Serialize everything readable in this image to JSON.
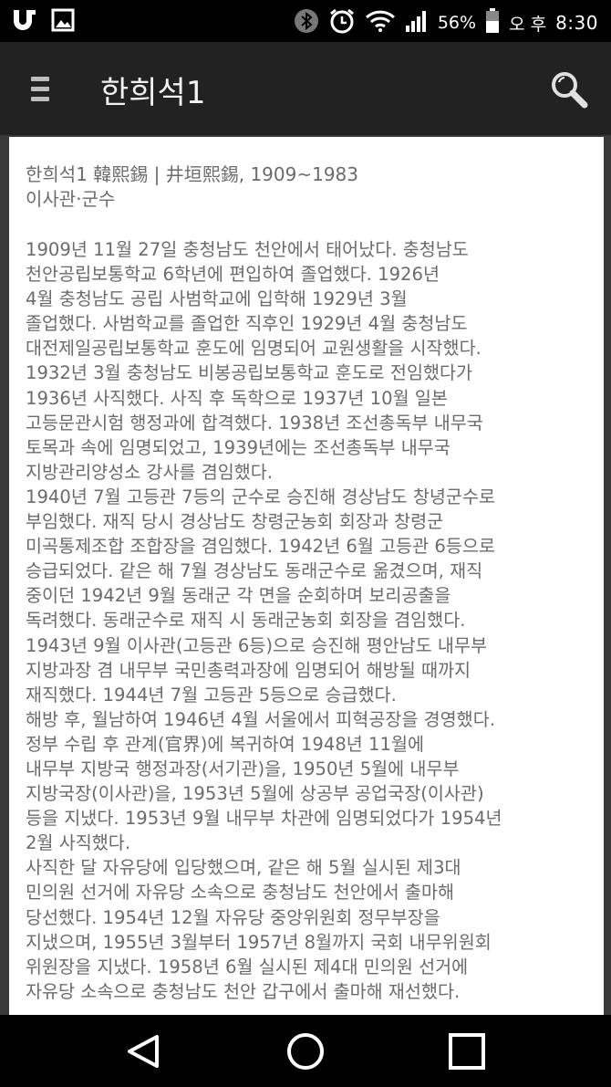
{
  "status_bar": {
    "battery_percent": "56%",
    "ampm": "오 후",
    "time": "8:30",
    "icons": [
      "u-plus-logo-icon",
      "gallery-icon",
      "bluetooth-icon",
      "alarm-icon",
      "wifi-icon",
      "signal-icon",
      "battery-icon"
    ]
  },
  "app_bar": {
    "title": "한희석1",
    "icons": [
      "menu-icon",
      "search-icon"
    ]
  },
  "article": {
    "heading": "한희석1 韓熙錫 | 井垣熙錫, 1909~1983",
    "subheading": "이사관·군수",
    "paragraphs": [
      "1909년 11월 27일 충청남도 천안에서 태어났다. 충청남도\n천안공립보통학교 6학년에 편입하여 졸업했다. 1926년\n4월 충청남도 공립 사범학교에 입학해 1929년 3월\n졸업했다. 사범학교를 졸업한 직후인 1929년 4월 충청남도\n대전제일공립보통학교 훈도에 임명되어 교원생활을 시작했다.\n1932년 3월 충청남도 비봉공립보통학교 훈도로 전임했다가\n1936년 사직했다. 사직 후 독학으로 1937년 10월 일본\n고등문관시험 행정과에 합격했다. 1938년 조선총독부 내무국\n토목과 속에 임명되었고, 1939년에는 조선총독부 내무국\n지방관리양성소 강사를 겸임했다.",
      "1940년 7월 고등관 7등의 군수로 승진해 경상남도 창녕군수로\n부임했다. 재직 당시 경상남도 창령군농회 회장과 창령군\n미곡통제조합 조합장을 겸임했다. 1942년 6월 고등관 6등으로\n승급되었다. 같은 해 7월 경상남도 동래군수로 옮겼으며, 재직\n중이던 1942년 9월 동래군 각 면을 순회하며 보리공출을\n독려했다. 동래군수로 재직 시 동래군농회 회장을 겸임했다.\n1943년 9월 이사관(고등관 6등)으로 승진해 평안남도 내무부\n지방과장 겸 내무부 국민총력과장에 임명되어 해방될 때까지\n재직했다. 1944년 7월 고등관 5등으로 승급했다.",
      "해방 후, 월남하여 1946년 4월 서울에서 피혁공장을 경영했다.\n정부 수립 후 관계(官界)에 복귀하여 1948년 11월에\n내무부 지방국 행정과장(서기관)을, 1950년 5월에 내무부\n지방국장(이사관)을, 1953년 5월에 상공부 공업국장(이사관)\n등을 지냈다. 1953년 9월 내무부 차관에 임명되었다가 1954년\n2월 사직했다.",
      "사직한 달 자유당에 입당했으며, 같은 해 5월 실시된 제3대\n민의원 선거에 자유당 소속으로 충청남도 천안에서 출마해\n당선했다. 1954년 12월 자유당 중앙위원회 정무부장을\n지냈으며, 1955년 3월부터 1957년 8월까지 국회 내무위원회\n위원장을 지냈다. 1958년 6월 실시된 제4대 민의원 선거에\n자유당 소속으로 충청남도 천안 갑구에서 출마해 재선했다."
    ]
  },
  "nav_bar": {
    "icons": [
      "back-icon",
      "home-icon",
      "recents-icon"
    ]
  }
}
